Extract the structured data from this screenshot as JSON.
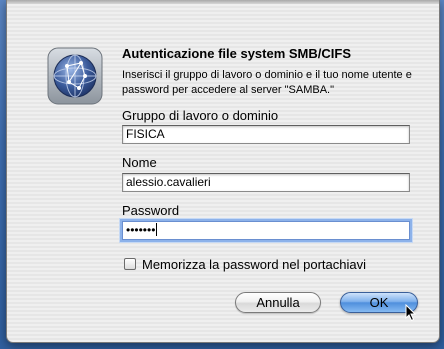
{
  "dialog": {
    "title": "Autenticazione file system SMB/CIFS",
    "message": "Inserisci il gruppo di lavoro o dominio e il tuo nome utente e password per accedere al server \"SAMBA.\"",
    "icon": "network-globe-icon"
  },
  "fields": {
    "workgroup": {
      "label": "Gruppo di lavoro o dominio",
      "value": "FISICA"
    },
    "name": {
      "label": "Nome",
      "value": "alessio.cavalieri"
    },
    "password": {
      "label": "Password",
      "value": "•••••••"
    }
  },
  "checkbox": {
    "label": "Memorizza la password nel portachiavi",
    "checked": false
  },
  "buttons": {
    "cancel": "Annulla",
    "ok": "OK"
  },
  "colors": {
    "accent": "#4f8fdd",
    "background": "#ececec"
  }
}
